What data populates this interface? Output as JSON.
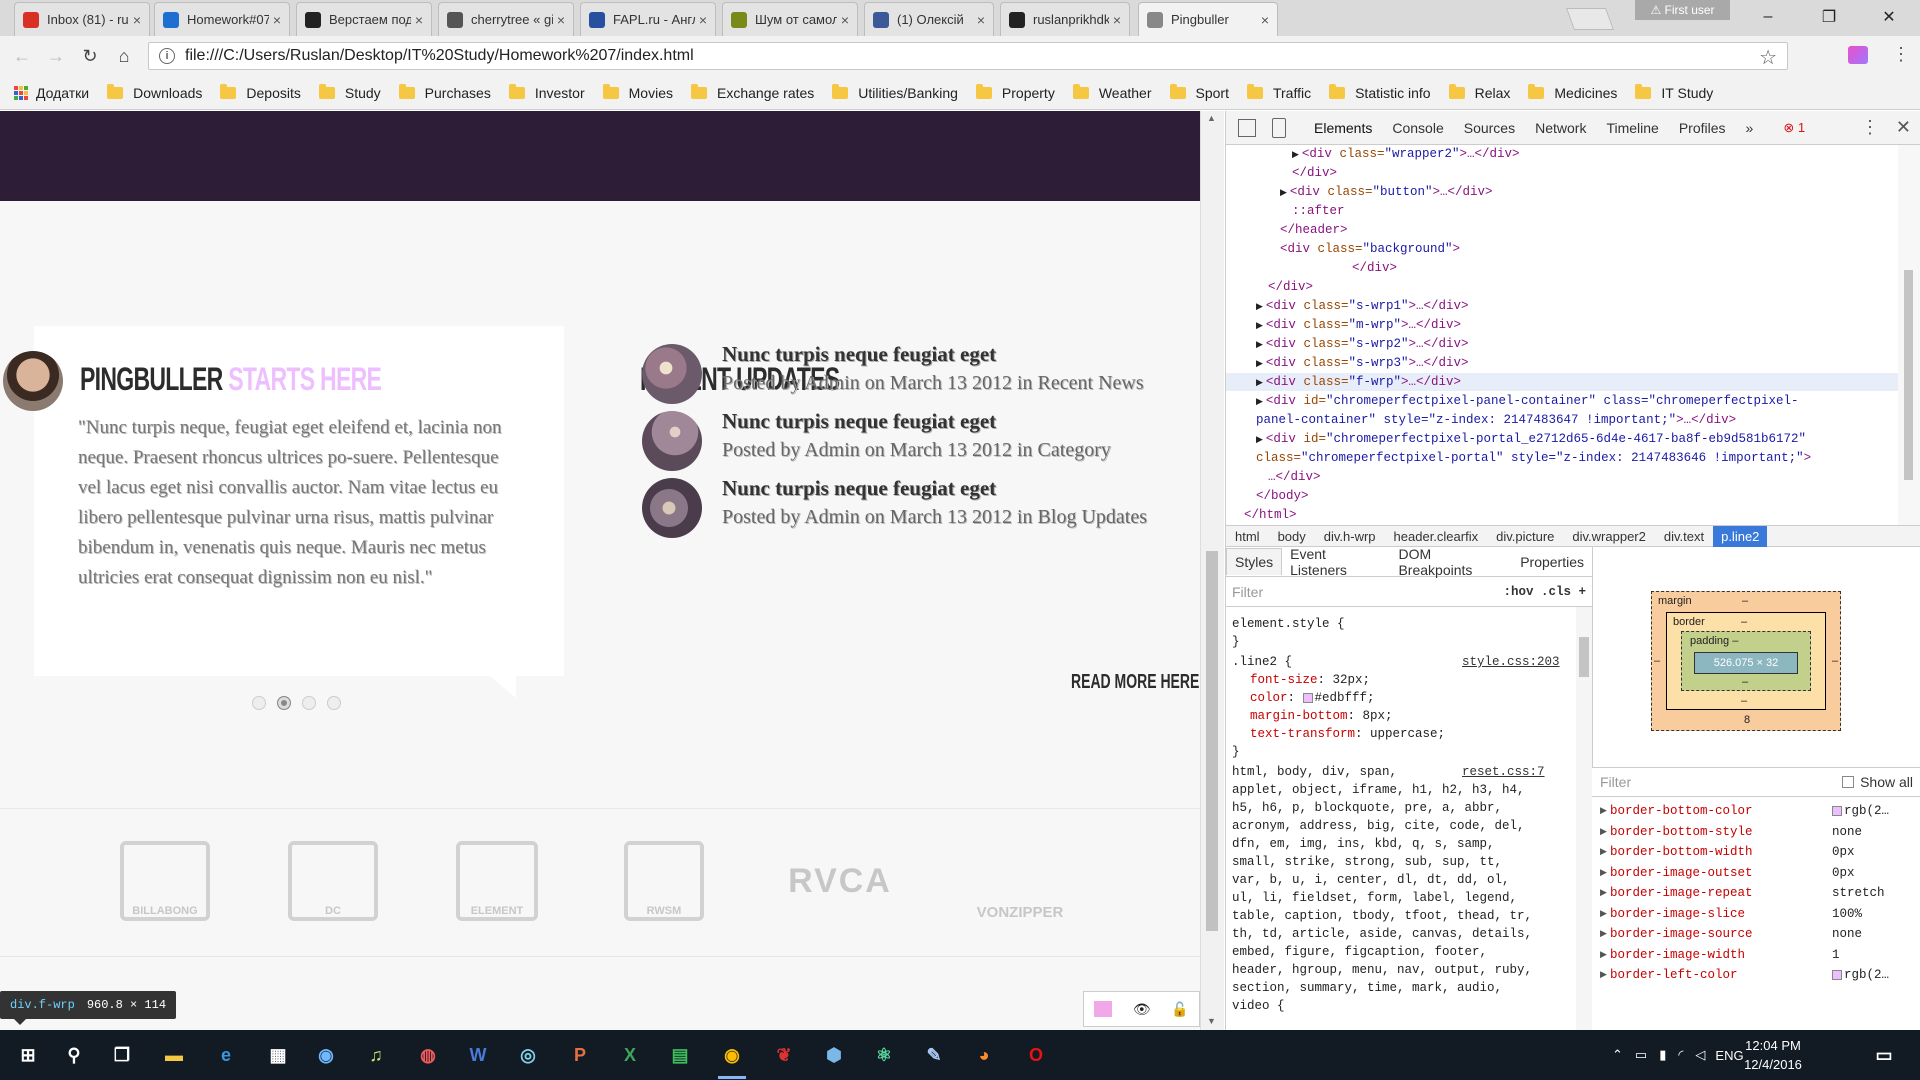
{
  "tabs": [
    {
      "label": "Inbox (81) - ru",
      "color": "#d93025"
    },
    {
      "label": "Homework#07",
      "color": "#1e6fd0"
    },
    {
      "label": "Верстаем под",
      "color": "#222222"
    },
    {
      "label": "cherrytree « gi",
      "color": "#555555"
    },
    {
      "label": "FAPL.ru - Англ",
      "color": "#2850a0"
    },
    {
      "label": "Шум от самол",
      "color": "#7a8a1a"
    },
    {
      "label": "(1) Олексій",
      "color": "#3b5998"
    },
    {
      "label": "ruslanprikhdk",
      "color": "#222222"
    },
    {
      "label": "Pingbuller",
      "color": "#888888"
    }
  ],
  "first_user": "First user",
  "address": {
    "url": "file:///C:/Users/Ruslan/Desktop/IT%20Study/Homework%207/index.html"
  },
  "bookmarks": [
    "Додатки",
    "Downloads",
    "Deposits",
    "Study",
    "Purchases",
    "Investor",
    "Movies",
    "Exchange rates",
    "Utilities/Banking",
    "Property",
    "Weather",
    "Sport",
    "Traffic",
    "Statistic info",
    "Relax",
    "Medicines",
    "IT Study"
  ],
  "page": {
    "pingbuller_title": "PINGBULLER",
    "pingbuller_accent": "STARTS HERE",
    "quote": "\"Nunc turpis neque, feugiat eget eleifend et, lacinia non neque. Praesent rhoncus ultrices po-suere. Pellentesque vel lacus eget nisi convallis auctor. Nam vitae lectus eu libero pellentesque pulvinar urna risus, mattis pulvinar bibendum in, venenatis quis neque. Mauris nec metus ultricies erat consequat dignissim non eu nisl.\"",
    "recent_title": "RECENT UPDATES",
    "updates": [
      {
        "title": "Nunc turpis neque feugiat eget",
        "meta": "Posted by Admin on March 13 2012 in Recent News"
      },
      {
        "title": "Nunc turpis neque feugiat eget",
        "meta": "Posted by Admin on March 13 2012 in Category"
      },
      {
        "title": "Nunc turpis neque feugiat eget",
        "meta": "Posted by Admin on March 13 2012 in Blog Updates"
      }
    ],
    "read_more": "READ MORE HERE",
    "brands": [
      "BILLABONG",
      "DC",
      "ELEMENT",
      "RWSM",
      "RVCA",
      "VONZIPPER"
    ]
  },
  "element_tooltip": {
    "selector": "div.f-wrp",
    "size": "960.8 × 114"
  },
  "devtools": {
    "tabs": [
      "Elements",
      "Console",
      "Sources",
      "Network",
      "Timeline",
      "Profiles"
    ],
    "more": "»",
    "errors": "1",
    "dom": [
      {
        "indent": 5,
        "arrow": "▶",
        "tag": "<div ",
        "an": "class=",
        "av": "\"wrapper2\"",
        "tail": ">…</div>"
      },
      {
        "indent": 5,
        "arrow": "",
        "tag": "</div>",
        "an": "",
        "av": "",
        "tail": ""
      },
      {
        "indent": 4,
        "arrow": "▶",
        "tag": "<div ",
        "an": "class=",
        "av": "\"button\"",
        "tail": ">…</div>"
      },
      {
        "indent": 5,
        "arrow": "",
        "tag": "::after",
        "an": "",
        "av": "",
        "tail": ""
      },
      {
        "indent": 4,
        "arrow": "",
        "tag": "</header>",
        "an": "",
        "av": "",
        "tail": ""
      },
      {
        "indent": 4,
        "arrow": "",
        "tag": "<div ",
        "an": "class=",
        "av": "\"background\"",
        "tail": ">"
      },
      {
        "indent": 10,
        "arrow": "",
        "tag": "</div>",
        "an": "",
        "av": "",
        "tail": ""
      },
      {
        "indent": 3,
        "arrow": "",
        "tag": "</div>",
        "an": "",
        "av": "",
        "tail": ""
      },
      {
        "indent": 2,
        "arrow": "▶",
        "tag": "<div ",
        "an": "class=",
        "av": "\"s-wrp1\"",
        "tail": ">…</div>"
      },
      {
        "indent": 2,
        "arrow": "▶",
        "tag": "<div ",
        "an": "class=",
        "av": "\"m-wrp\"",
        "tail": ">…</div>"
      },
      {
        "indent": 2,
        "arrow": "▶",
        "tag": "<div ",
        "an": "class=",
        "av": "\"s-wrp2\"",
        "tail": ">…</div>"
      },
      {
        "indent": 2,
        "arrow": "▶",
        "tag": "<div ",
        "an": "class=",
        "av": "\"s-wrp3\"",
        "tail": ">…</div>"
      },
      {
        "indent": 2,
        "arrow": "▶",
        "tag": "<div ",
        "an": "class=",
        "av": "\"f-wrp\"",
        "tail": ">…</div>"
      },
      {
        "indent": 2,
        "arrow": "▶",
        "tag": "<div ",
        "an": "id=",
        "av": "\"chromeperfectpixel-panel-container\" class=\"chromeperfectpixel-",
        "tail": ""
      },
      {
        "indent": 2,
        "arrow": "",
        "tag": "",
        "an": "",
        "av": "panel-container\" style=\"z-index: 2147483647 !important;\"",
        "tail": ">…</div>"
      },
      {
        "indent": 2,
        "arrow": "▶",
        "tag": "<div ",
        "an": "id=",
        "av": "\"chromeperfectpixel-portal_e2712d65-6d4e-4617-ba8f-eb9d581b6172\"",
        "tail": ""
      },
      {
        "indent": 2,
        "arrow": "",
        "tag": "",
        "an": "class=",
        "av": "\"chromeperfectpixel-portal\" style=\"z-index: 2147483646 !important;\"",
        "tail": ">"
      },
      {
        "indent": 3,
        "arrow": "",
        "tag": "…</div>",
        "an": "",
        "av": "",
        "tail": ""
      },
      {
        "indent": 2,
        "arrow": "",
        "tag": "</body>",
        "an": "",
        "av": "",
        "tail": ""
      },
      {
        "indent": 1,
        "arrow": "",
        "tag": "</html>",
        "an": "",
        "av": "",
        "tail": ""
      }
    ],
    "breadcrumbs": [
      "html",
      "body",
      "div.h-wrp",
      "header.clearfix",
      "div.picture",
      "div.wrapper2",
      "div.text",
      "p.line2"
    ],
    "subtabs": [
      "Styles",
      "Event Listeners",
      "DOM Breakpoints",
      "Properties"
    ],
    "filter_placeholder": "Filter",
    "filter_right": ":hov  .cls  +",
    "styles": [
      {
        "text": "element.style {",
        "src": ""
      },
      {
        "text": "}",
        "src": ""
      },
      {
        "text": ".line2 {",
        "src": "style.css:203"
      },
      {
        "prop": "font-size",
        "val": "32px;"
      },
      {
        "prop": "color",
        "val": "#edbfff;",
        "swatch": true
      },
      {
        "prop": "margin-bottom",
        "val": "8px;"
      },
      {
        "prop": "text-transform",
        "val": "uppercase;"
      },
      {
        "text": "}",
        "src": ""
      },
      {
        "text": "html, body, div, span,",
        "src": "reset.css:7"
      },
      {
        "text": "applet, object, iframe, h1, h2, h3, h4,",
        "src": ""
      },
      {
        "text": "h5, h6, p, blockquote, pre, a, abbr,",
        "src": ""
      },
      {
        "text": "acronym, address, big, cite, code, del,",
        "src": ""
      },
      {
        "text": "dfn, em, img, ins, kbd, q, s, samp,",
        "src": ""
      },
      {
        "text": "small, strike, strong, sub, sup, tt,",
        "src": ""
      },
      {
        "text": "var, b, u, i, center, dl, dt, dd, ol,",
        "src": ""
      },
      {
        "text": "ul, li, fieldset, form, label, legend,",
        "src": ""
      },
      {
        "text": "table, caption, tbody, tfoot, thead, tr,",
        "src": ""
      },
      {
        "text": "th, td, article, aside, canvas, details,",
        "src": ""
      },
      {
        "text": "embed, figure, figcaption, footer,",
        "src": ""
      },
      {
        "text": "header, hgroup, menu, nav, output, ruby,",
        "src": ""
      },
      {
        "text": "section, summary, time, mark, audio,",
        "src": ""
      },
      {
        "text": "video {",
        "src": ""
      }
    ],
    "box_model": {
      "margin_label": "margin",
      "margin_top": "–",
      "margin_bottom": "8",
      "margin_side": "–",
      "border_label": "border",
      "border_top": "–",
      "border_bottom": "–",
      "padding_label": "padding –",
      "padding_bottom": "–",
      "content": "526.075 × 32"
    },
    "computed_filter": "Filter",
    "show_all": "Show all",
    "computed": [
      {
        "prop": "border-bottom-color",
        "val": "rgb(2…",
        "swatch": true
      },
      {
        "prop": "border-bottom-style",
        "val": "none"
      },
      {
        "prop": "border-bottom-width",
        "val": "0px"
      },
      {
        "prop": "border-image-outset",
        "val": "0px"
      },
      {
        "prop": "border-image-repeat",
        "val": "stretch"
      },
      {
        "prop": "border-image-slice",
        "val": "100%"
      },
      {
        "prop": "border-image-source",
        "val": "none"
      },
      {
        "prop": "border-image-width",
        "val": "1"
      },
      {
        "prop": "border-left-color",
        "val": "rgb(2…",
        "swatch": true
      }
    ]
  },
  "taskbar": {
    "lang": "ENG",
    "time": "12:04 PM",
    "date": "12/4/2016"
  }
}
